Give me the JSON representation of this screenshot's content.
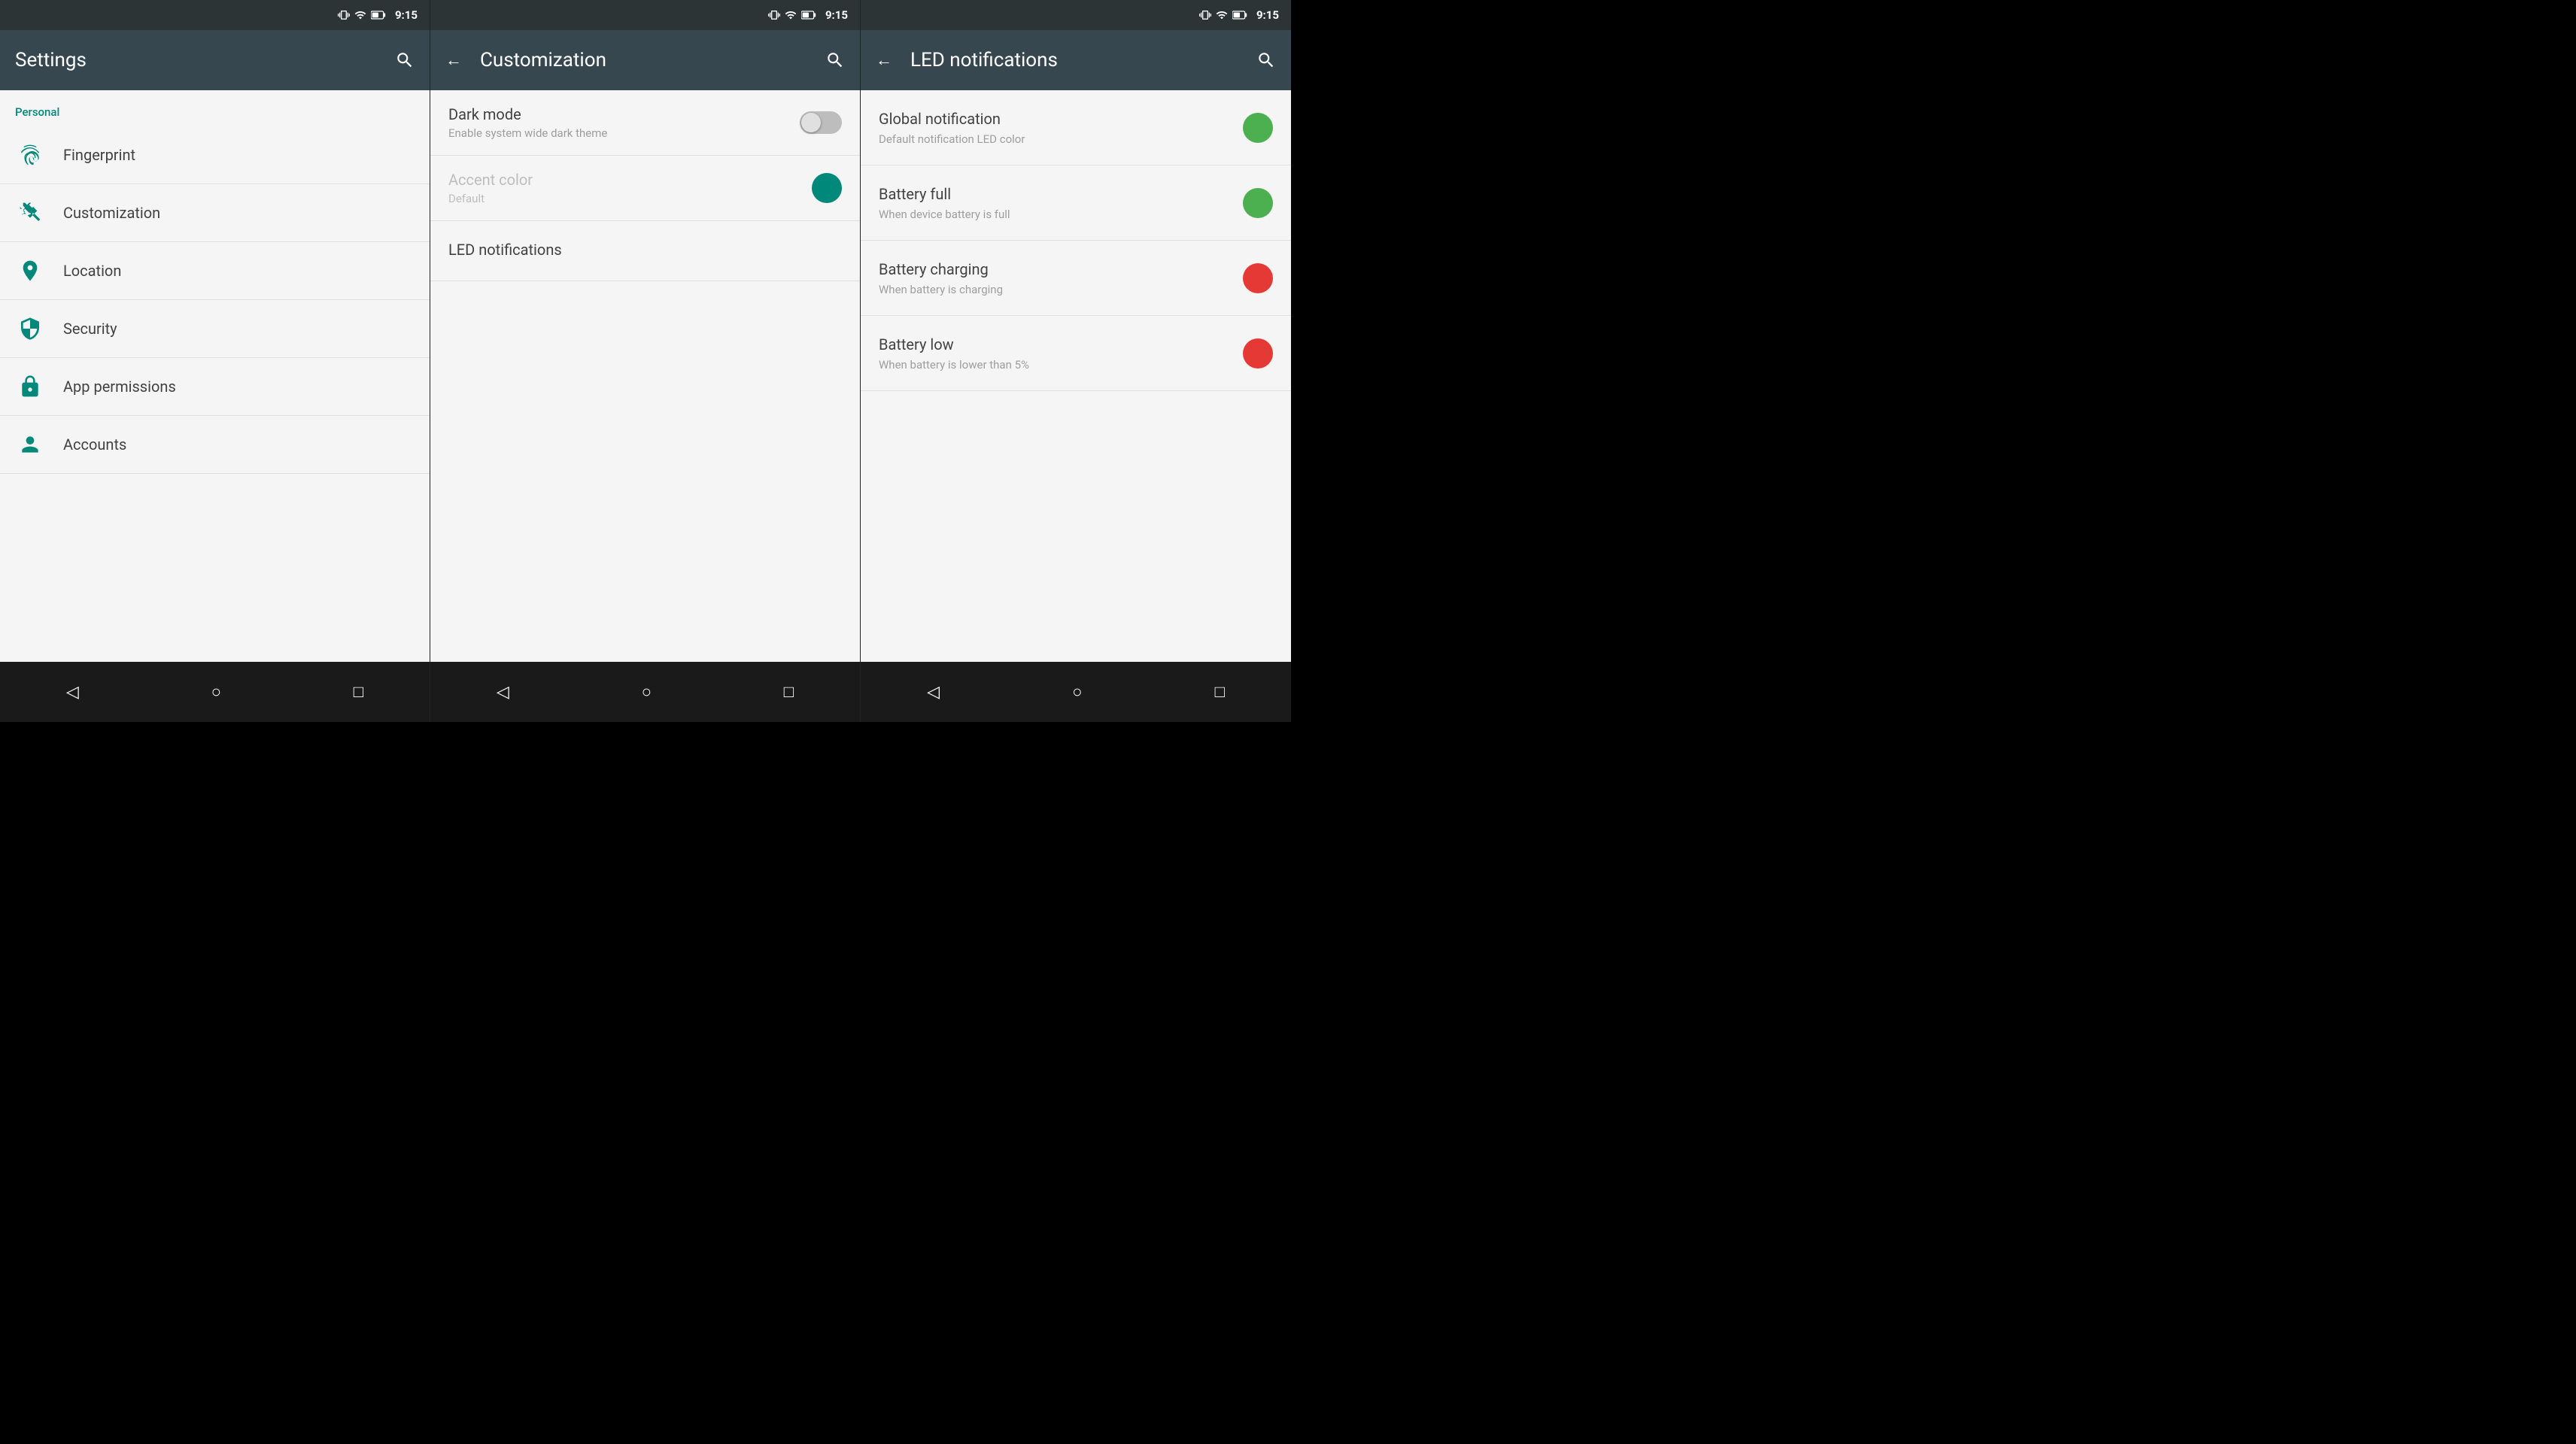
{
  "panels": {
    "settings": {
      "status_bar": {
        "time": "9:15"
      },
      "app_bar": {
        "title": "Settings",
        "search_label": "search"
      },
      "section_label": "Personal",
      "items": [
        {
          "id": "fingerprint",
          "label": "Fingerprint",
          "icon": "fingerprint"
        },
        {
          "id": "customization",
          "label": "Customization",
          "icon": "customization"
        },
        {
          "id": "location",
          "label": "Location",
          "icon": "location"
        },
        {
          "id": "security",
          "label": "Security",
          "icon": "security"
        },
        {
          "id": "app-permissions",
          "label": "App permissions",
          "icon": "app-permissions"
        },
        {
          "id": "accounts",
          "label": "Accounts",
          "icon": "accounts"
        }
      ],
      "nav": {
        "back": "◁",
        "home": "○",
        "recents": "□"
      }
    },
    "customization": {
      "status_bar": {
        "time": "9:15"
      },
      "app_bar": {
        "title": "Customization",
        "back_label": "back",
        "search_label": "search"
      },
      "items": [
        {
          "id": "dark-mode",
          "title": "Dark mode",
          "subtitle": "Enable system wide dark theme",
          "type": "toggle",
          "toggle_on": false
        },
        {
          "id": "accent-color",
          "title": "Accent color",
          "subtitle": "Default",
          "type": "color",
          "color": "#00897b",
          "dimmed": true
        },
        {
          "id": "led-notifications",
          "title": "LED notifications",
          "type": "nav"
        }
      ],
      "nav": {
        "back": "◁",
        "home": "○",
        "recents": "□"
      }
    },
    "led_notifications": {
      "status_bar": {
        "time": "9:15"
      },
      "app_bar": {
        "title": "LED notifications",
        "back_label": "back",
        "search_label": "search"
      },
      "items": [
        {
          "id": "global-notification",
          "title": "Global notification",
          "subtitle": "Default notification LED color",
          "color": "#4caf50"
        },
        {
          "id": "battery-full",
          "title": "Battery full",
          "subtitle": "When device battery is full",
          "color": "#4caf50"
        },
        {
          "id": "battery-charging",
          "title": "Battery charging",
          "subtitle": "When battery is charging",
          "color": "#e53935"
        },
        {
          "id": "battery-low",
          "title": "Battery low",
          "subtitle": "When battery is lower than 5%",
          "color": "#e53935"
        }
      ],
      "nav": {
        "back": "◁",
        "home": "○",
        "recents": "□"
      }
    }
  }
}
